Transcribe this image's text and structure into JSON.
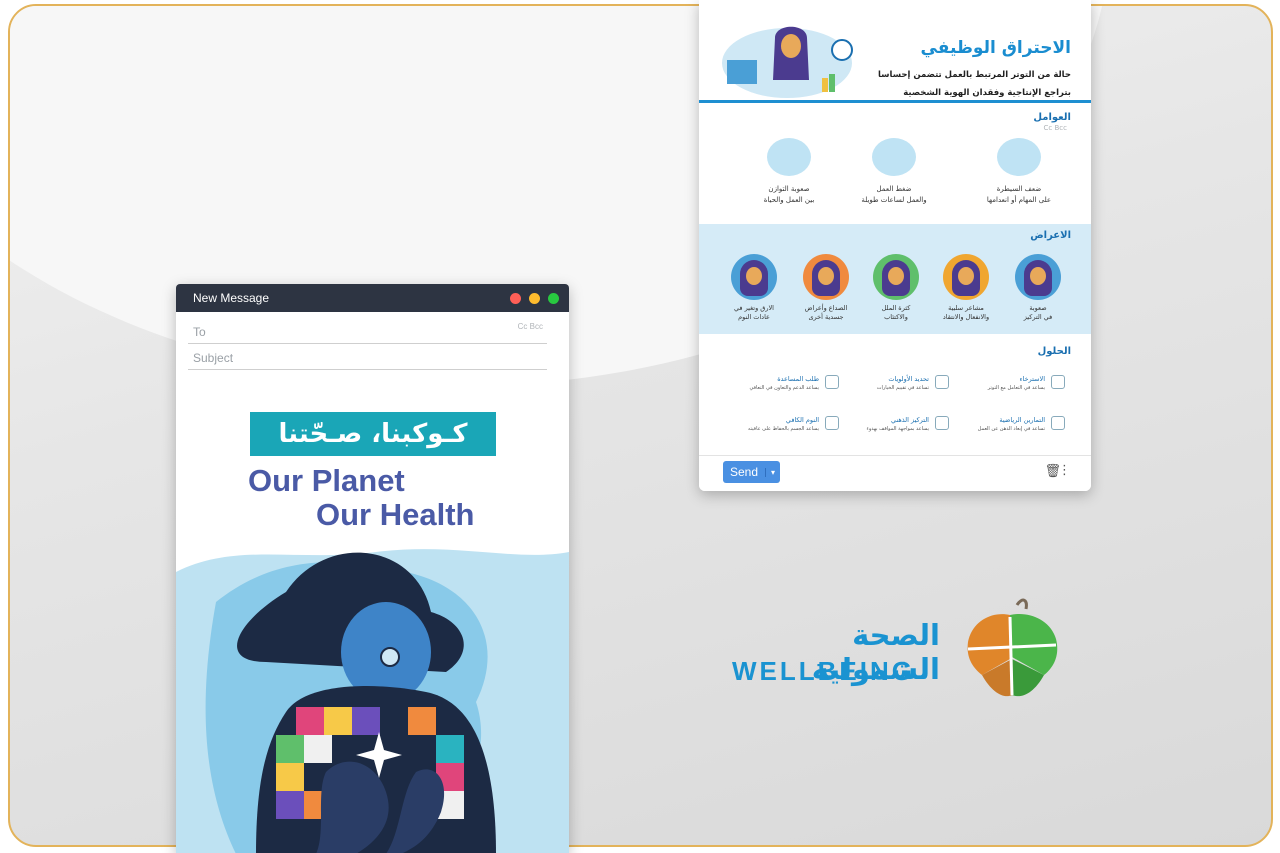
{
  "left_window": {
    "title": "New Message",
    "to_placeholder": "To",
    "subject_placeholder": "Subject",
    "cc_bcc": "Cc Bcc",
    "window_buttons": {
      "close_color": "#ff5f57",
      "minimize_color": "#febc2e",
      "maximize_color": "#28c840"
    },
    "poster": {
      "arabic_title": "كـوكبنا، صـحّتنا",
      "title_line1": "Our Planet",
      "title_line2": "Our Health"
    }
  },
  "right_window": {
    "header": {
      "title": "الاحتراق الوظيفي",
      "desc_line1": "حالة من التوتر المرتبط بالعمل تتضمن إحساسا",
      "desc_line2": "بتراجع الإنتاجية وفقدان الهوية الشخصية"
    },
    "factors": {
      "title": "العوامل",
      "cc_bcc": "Cc Bcc",
      "items": [
        {
          "line1": "ضعف السيطرة",
          "line2": "على المهام أو انعدامها"
        },
        {
          "line1": "ضغط العمل",
          "line2": "والعمل لساعات طويلة"
        },
        {
          "line1": "صعوبة التوازن",
          "line2": "بين العمل والحياة"
        }
      ]
    },
    "symptoms": {
      "title": "الاعراض",
      "items": [
        {
          "line1": "صعوبة",
          "line2": "في التركيز"
        },
        {
          "line1": "مشاعر سلبية",
          "line2": "والانفعال والانتقاد"
        },
        {
          "line1": "كثرة الملل",
          "line2": "والاكتئاب"
        },
        {
          "line1": "الصداع وأعراض",
          "line2": "جسدية أخرى"
        },
        {
          "line1": "الارق وتغير في",
          "line2": "عادات النوم"
        }
      ]
    },
    "solutions": {
      "title": "الحلول",
      "items": [
        {
          "label": "الاسترخاء",
          "sub": "يساعد في التعامل مع التوتر"
        },
        {
          "label": "تحديد الأولويات",
          "sub": "تساعد في تقييم الخيارات"
        },
        {
          "label": "طلب المساعدة",
          "sub": "يساعد الدعم والتعاون في التعافي"
        },
        {
          "label": "التمارين الرياضية",
          "sub": "تساعد في إبعاد الذهن عن العمل"
        },
        {
          "label": "التركيز الذهني",
          "sub": "يساعد بمواجهة المواقف بهدوء"
        },
        {
          "label": "النوم الكافي",
          "sub": "يساعد الجسم بالحفاظ على عافيته"
        }
      ]
    },
    "send_label": "Send",
    "accent_color": "#1e8fd1"
  },
  "logo": {
    "arabic": "الصحة الشمولية",
    "english": "WELLBEING"
  }
}
